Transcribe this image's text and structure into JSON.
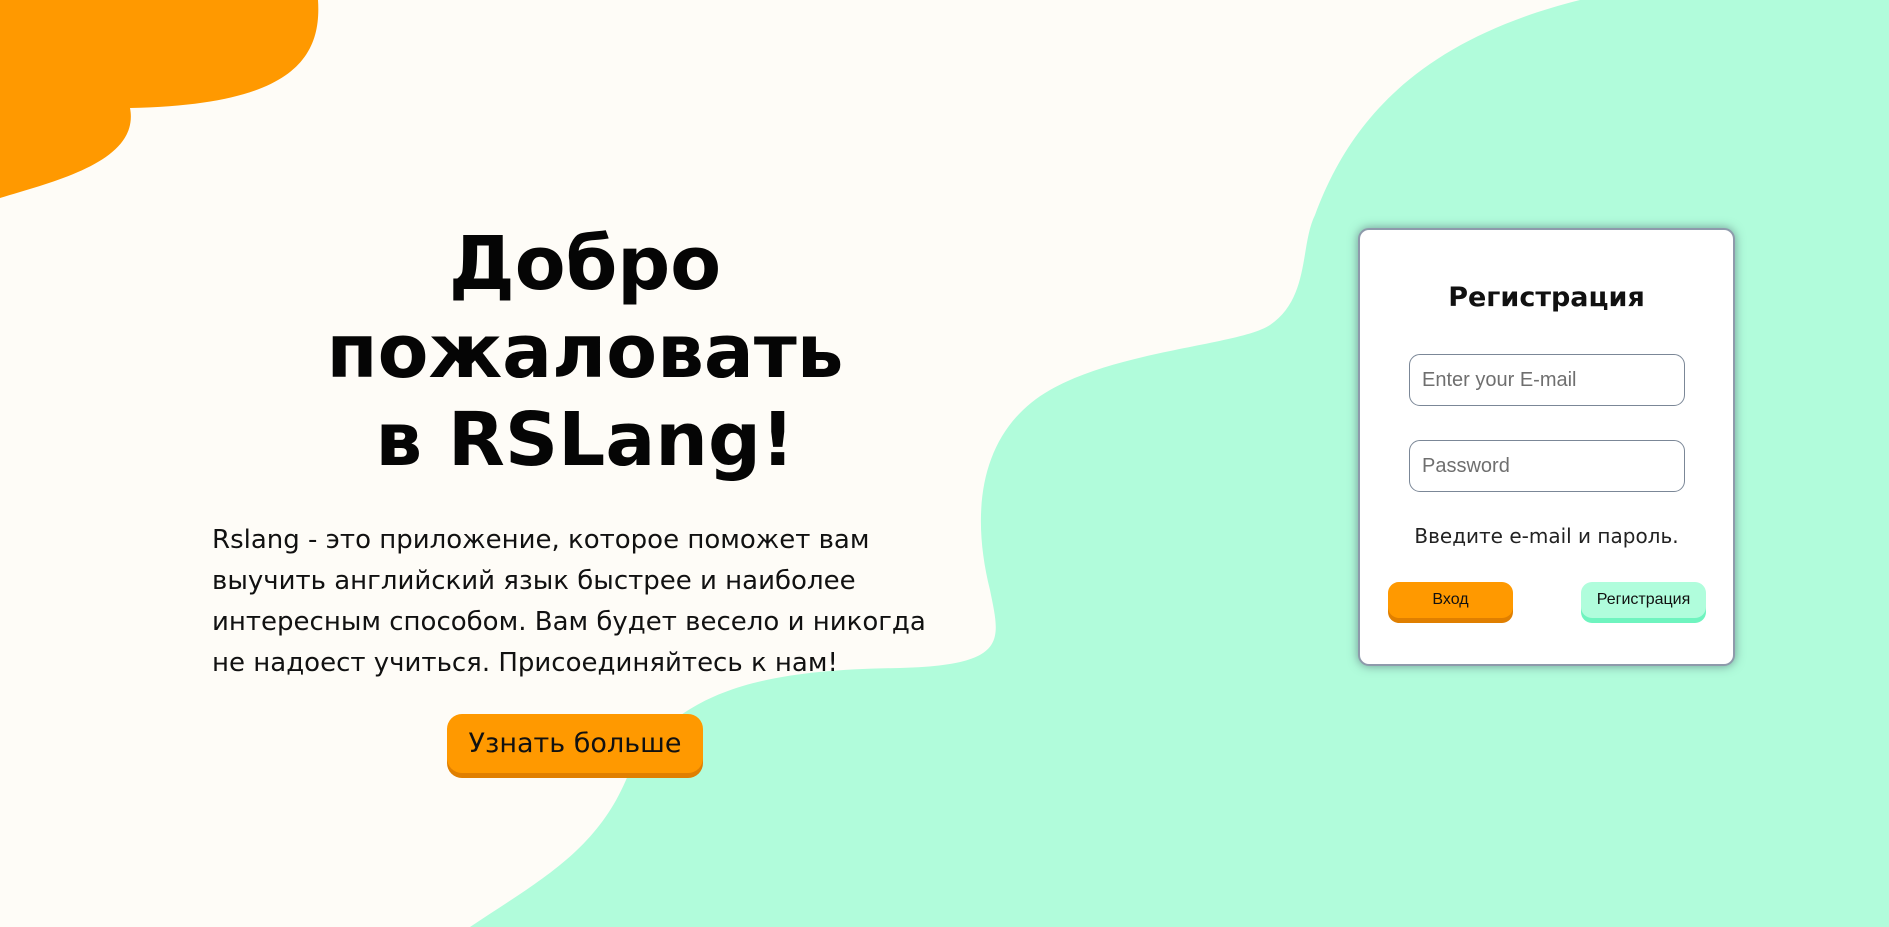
{
  "colors": {
    "background": "#fefcf7",
    "accent_orange": "#ff9900",
    "accent_mint": "#b0fddc"
  },
  "hero": {
    "title_line1": "Добро пожаловать",
    "title_line2": "в RSLang!",
    "description": "Rslang - это приложение, которое поможет вам выучить английский язык быстрее и наиболее интересным способом. Вам будет весело и никогда не надоест учиться. Присоединяйтесь к нам!",
    "learn_more_label": "Узнать больше"
  },
  "auth_form": {
    "title": "Регистрация",
    "email_placeholder": "Enter your E-mail",
    "password_placeholder": "Password",
    "hint": "Введите e-mail и пароль.",
    "login_label": "Вход",
    "register_label": "Регистрация"
  }
}
